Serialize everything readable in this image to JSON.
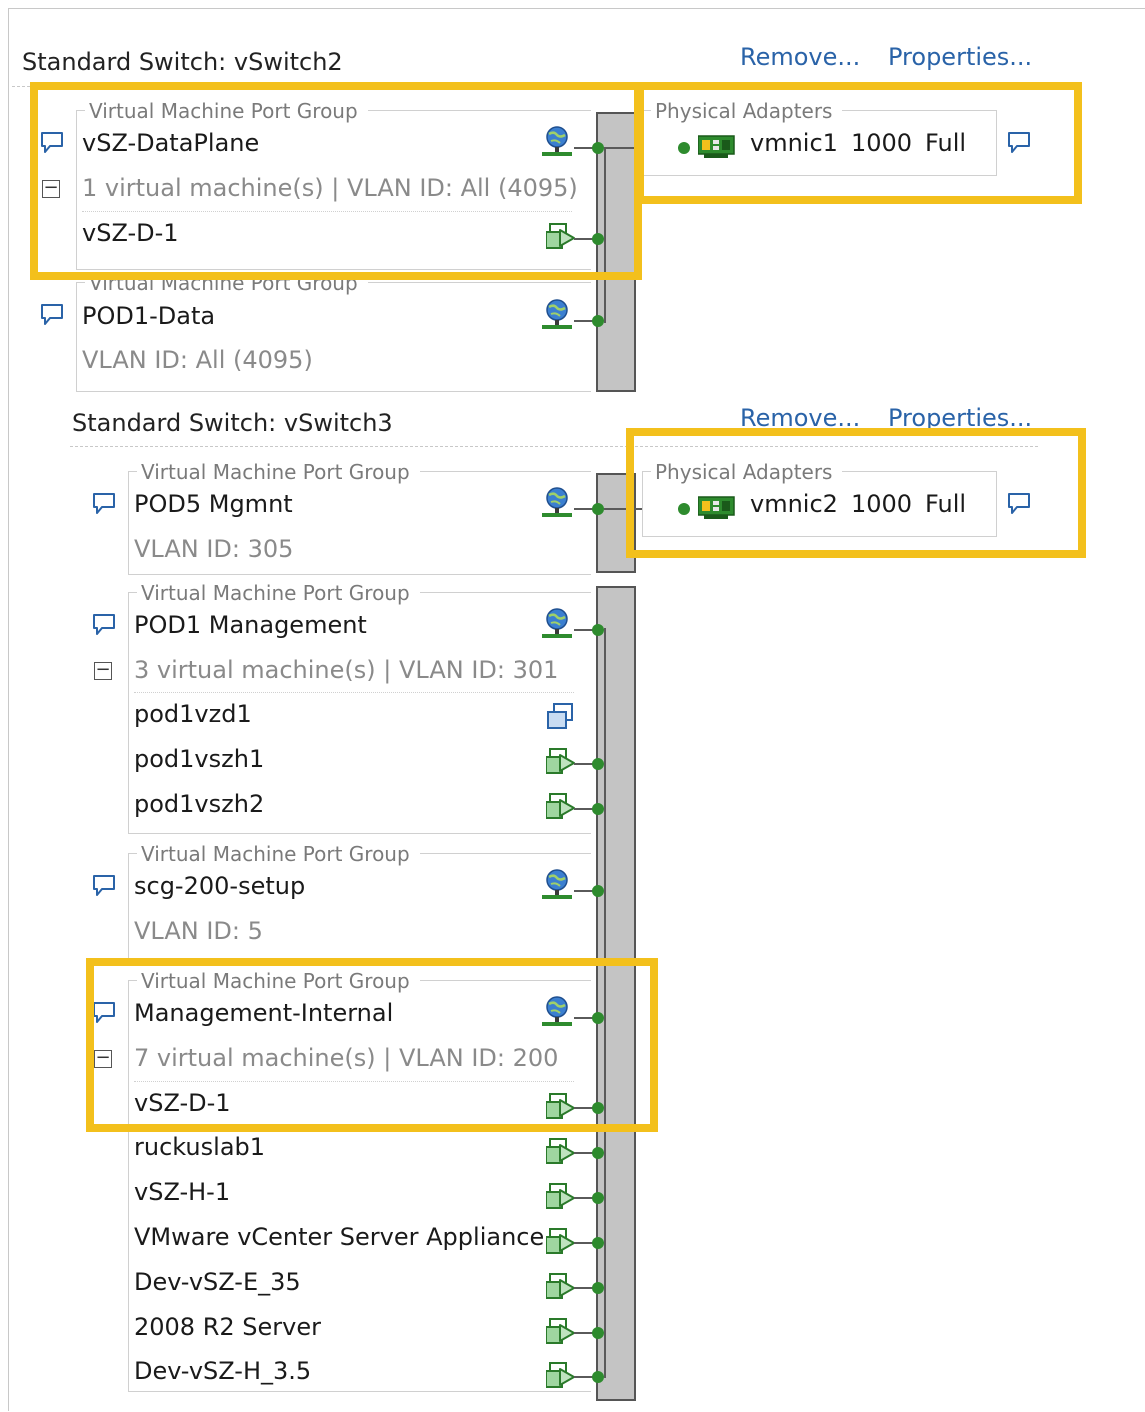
{
  "switches": [
    {
      "title": "Standard Switch: vSwitch2",
      "remove_label": "Remove...",
      "properties_label": "Properties...",
      "physical_adapters_label": "Physical Adapters",
      "adapter": {
        "name": "vmnic1",
        "speed": "1000",
        "duplex": "Full"
      },
      "port_groups": [
        {
          "legend": "Virtual Machine Port Group",
          "name": "vSZ-DataPlane",
          "info": "1 virtual machine(s) | VLAN ID: All (4095)",
          "vms": [
            "vSZ-D-1"
          ]
        },
        {
          "legend": "Virtual Machine Port Group",
          "name": "POD1-Data",
          "info": "VLAN ID: All (4095)",
          "vms": []
        }
      ]
    },
    {
      "title": "Standard Switch: vSwitch3",
      "remove_label": "Remove...",
      "properties_label": "Properties...",
      "physical_adapters_label": "Physical Adapters",
      "adapter": {
        "name": "vmnic2",
        "speed": "1000",
        "duplex": "Full"
      },
      "port_groups": [
        {
          "legend": "Virtual Machine Port Group",
          "name": "POD5 Mgmnt",
          "info": "VLAN ID: 305",
          "vms": []
        },
        {
          "legend": "Virtual Machine Port Group",
          "name": "POD1 Management",
          "info": "3 virtual machine(s) | VLAN ID: 301",
          "vms": [
            "pod1vzd1",
            "pod1vszh1",
            "pod1vszh2"
          ]
        },
        {
          "legend": "Virtual Machine Port Group",
          "name": "scg-200-setup",
          "info": "VLAN ID: 5",
          "vms": []
        },
        {
          "legend": "Virtual Machine Port Group",
          "name": "Management-Internal",
          "info": "7 virtual machine(s) | VLAN ID: 200",
          "vms": [
            "vSZ-D-1",
            "ruckuslab1",
            "vSZ-H-1",
            "VMware vCenter Server Appliance",
            "Dev-vSZ-E_35",
            "2008 R2 Server",
            "Dev-vSZ-H_3.5"
          ]
        }
      ]
    }
  ],
  "colors": {
    "highlight": "#f3c01c",
    "link": "#2a63a8",
    "port_green": "#2e8b2e"
  }
}
